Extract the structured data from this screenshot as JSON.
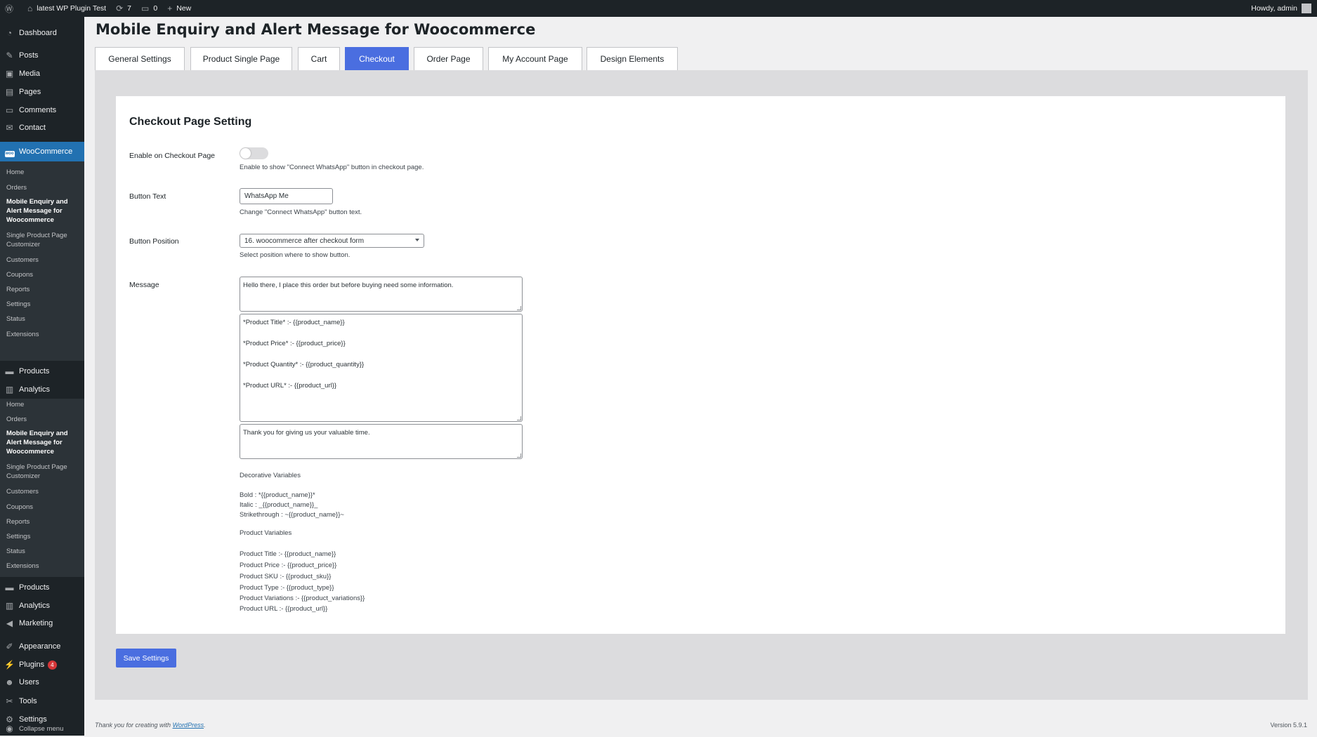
{
  "admin_bar": {
    "site_name": "latest WP Plugin Test",
    "updates_count": "7",
    "comments_count": "0",
    "new_label": "New",
    "howdy": "Howdy, admin"
  },
  "sidebar": {
    "dashboard": "Dashboard",
    "posts": "Posts",
    "media": "Media",
    "pages": "Pages",
    "comments": "Comments",
    "contact": "Contact",
    "woocommerce": "WooCommerce",
    "woo_submenu": [
      "Home",
      "Orders",
      "Mobile Enquiry and Alert Message for Woocommerce",
      "Single Product Page Customizer",
      "Customers",
      "Coupons",
      "Reports",
      "Settings",
      "Status",
      "Extensions"
    ],
    "products": "Products",
    "analytics": "Analytics",
    "flyout_submenu": [
      "Home",
      "Orders",
      "Mobile Enquiry and Alert Message for Woocommerce",
      "Single Product Page Customizer",
      "Customers",
      "Coupons",
      "Reports",
      "Settings",
      "Status",
      "Extensions"
    ],
    "products2": "Products",
    "analytics2": "Analytics",
    "marketing": "Marketing",
    "appearance": "Appearance",
    "plugins": "Plugins",
    "plugins_count": "4",
    "users": "Users",
    "tools": "Tools",
    "settings": "Settings",
    "collapse": "Collapse menu"
  },
  "page": {
    "title": "Mobile Enquiry and Alert Message for Woocommerce",
    "tabs": [
      "General Settings",
      "Product Single Page",
      "Cart",
      "Checkout",
      "Order Page",
      "My Account Page",
      "Design Elements"
    ],
    "active_tab": "Checkout"
  },
  "checkout": {
    "section_title": "Checkout Page Setting",
    "enable_label": "Enable on Checkout Page",
    "enable_checked": false,
    "enable_desc": "Enable to show \"Connect WhatsApp\" button in checkout page.",
    "button_text_label": "Button Text",
    "button_text_value": "WhatsApp Me",
    "button_text_desc": "Change \"Connect WhatsApp\" button text.",
    "button_position_label": "Button Position",
    "button_position_value": "16. woocommerce after checkout form",
    "button_position_desc": "Select position where to show button.",
    "message_label": "Message",
    "message_header": "Hello there, I place this order but before buying need some information.",
    "message_body": "*Product Title* :- {{product_name}}\n\n*Product Price* :- {{product_price}}\n\n*Product Quantity* :- {{product_quantity}}\n\n*Product URL* :- {{product_url}}",
    "message_footer": "Thank you for giving us your valuable time.",
    "decorative_title": "Decorative Variables",
    "decorative_vars": [
      "Bold : *{{product_name}}*",
      "Italic : _{{product_name}}_",
      "Strikethrough : ~{{product_name}}~"
    ],
    "product_vars_title": "Product Variables",
    "product_vars": [
      "Product Title :- {{product_name}}",
      "Product Price :- {{product_price}}",
      "Product SKU :- {{product_sku}}",
      "Product Type :- {{product_type}}",
      "Product Variations :- {{product_variations}}",
      "Product URL :- {{product_url}}"
    ],
    "save_label": "Save Settings"
  },
  "footer": {
    "thanks_prefix": "Thank you for creating with ",
    "wordpress_link": "WordPress",
    "thanks_suffix": ".",
    "version": "Version 5.9.1"
  },
  "colors": {
    "accent": "#4a6ee0",
    "admin_dark": "#1d2327",
    "wp_blue": "#2271b1"
  }
}
